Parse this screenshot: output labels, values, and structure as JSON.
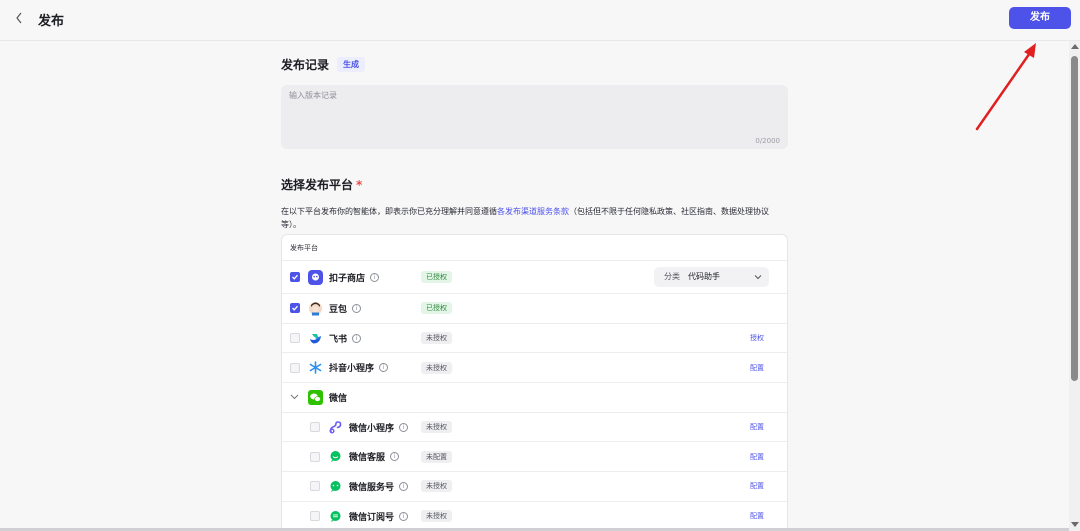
{
  "header": {
    "back_icon": "chevron-left-icon",
    "title": "发布",
    "publish_label": "发布"
  },
  "record": {
    "title": "发布记录",
    "generate_label": "生成",
    "placeholder": "输入版本记录",
    "counter": "0/2000"
  },
  "platform": {
    "title": "选择发布平台",
    "required_mark": "*",
    "desc_prefix": "在以下平台发布你的智能体，即表示你已充分理解并同意遵循",
    "desc_link": "各发布渠道服务条款",
    "desc_suffix": "（包括但不限于任何隐私政策、社区指南、数据处理协议等）。",
    "table_header": "发布平台",
    "category_label": "分类",
    "category_value": "代码助手",
    "rows": [
      {
        "name": "扣子商店",
        "status": "已授权",
        "status_type": "ok",
        "checked": true,
        "action": "",
        "indent": false,
        "icon": "coze-store-icon",
        "info": true
      },
      {
        "name": "豆包",
        "status": "已授权",
        "status_type": "ok",
        "checked": true,
        "action": "",
        "indent": false,
        "icon": "doubao-icon",
        "info": true
      },
      {
        "name": "飞书",
        "status": "未授权",
        "status_type": "no",
        "checked": false,
        "action": "授权",
        "indent": false,
        "icon": "feishu-icon",
        "info": true
      },
      {
        "name": "抖音小程序",
        "status": "未授权",
        "status_type": "no",
        "checked": false,
        "action": "配置",
        "indent": false,
        "icon": "douyin-miniapp-icon",
        "info": true
      },
      {
        "name": "微信",
        "status": "",
        "status_type": "",
        "checked": false,
        "action": "",
        "indent": false,
        "icon": "wechat-icon",
        "info": false,
        "group": true
      },
      {
        "name": "微信小程序",
        "status": "未授权",
        "status_type": "no",
        "checked": false,
        "action": "配置",
        "indent": true,
        "icon": "wechat-miniapp-icon",
        "info": true
      },
      {
        "name": "微信客服",
        "status": "未配置",
        "status_type": "no",
        "checked": false,
        "action": "配置",
        "indent": true,
        "icon": "wechat-service-icon",
        "info": true
      },
      {
        "name": "微信服务号",
        "status": "未授权",
        "status_type": "no",
        "checked": false,
        "action": "配置",
        "indent": true,
        "icon": "wechat-official-icon",
        "info": true
      },
      {
        "name": "微信订阅号",
        "status": "未授权",
        "status_type": "no",
        "checked": false,
        "action": "配置",
        "indent": true,
        "icon": "wechat-subscription-icon",
        "info": true
      }
    ]
  },
  "colors": {
    "accent": "#4d53e8",
    "ok_bg": "#e3f5e6",
    "ok_fg": "#2e8a3e",
    "annotation_arrow": "#e02020"
  }
}
